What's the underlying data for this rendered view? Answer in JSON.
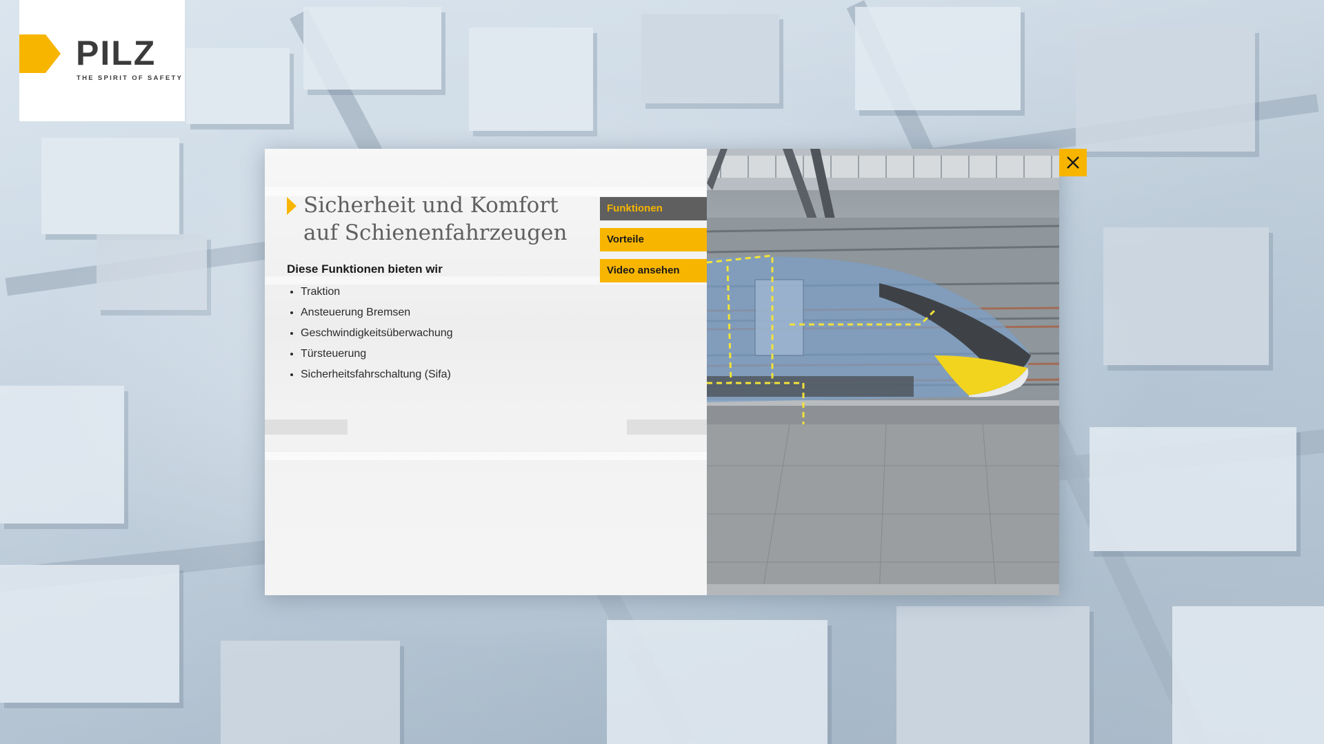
{
  "brand": {
    "name": "PILZ",
    "tagline": "THE SPIRIT OF SAFETY",
    "accent_color": "#f7b500",
    "text_color": "#3b3b3b"
  },
  "modal": {
    "title": "Sicherheit und Komfort auf Schienenfahrzeugen",
    "subheading": "Diese Funktionen bieten wir",
    "features": [
      "Traktion",
      "Ansteuerung Bremsen",
      "Geschwindigkeitsüberwachung",
      "Türsteuerung",
      "Sicherheitsfahrschaltung (Sifa)"
    ],
    "tabs": [
      {
        "label": "Funktionen",
        "active": true
      },
      {
        "label": "Vorteile",
        "active": false
      },
      {
        "label": "Video ansehen",
        "active": false
      }
    ],
    "close_icon": "close-icon",
    "visual_icon": "train-illustration"
  }
}
